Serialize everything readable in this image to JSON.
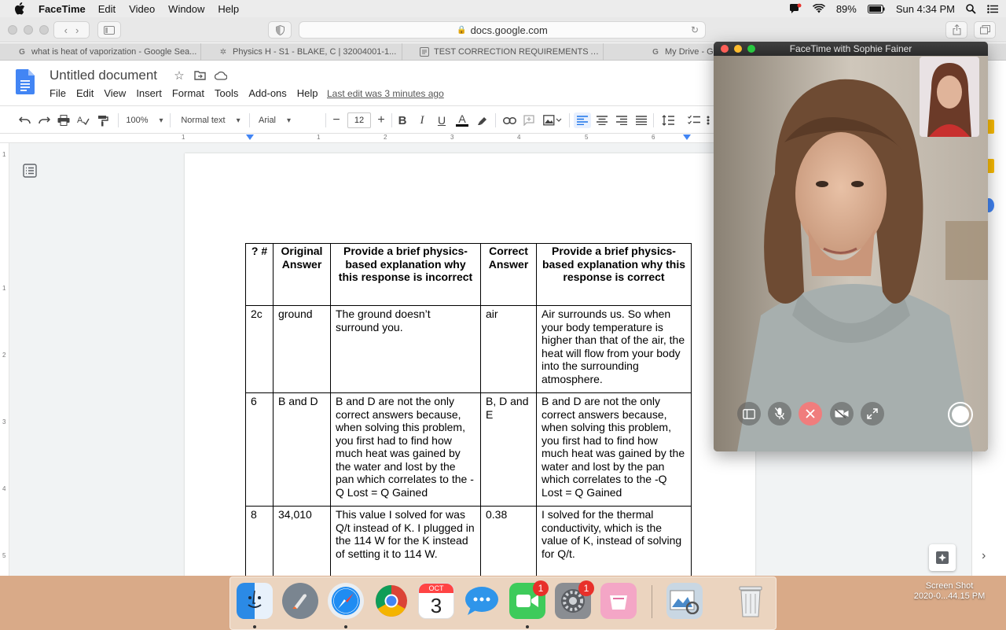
{
  "menubar": {
    "app_name": "FaceTime",
    "menus": [
      "Edit",
      "Video",
      "Window",
      "Help"
    ],
    "battery_percent": "89%",
    "clock": "Sun 4:34 PM"
  },
  "safari": {
    "address": "docs.google.com",
    "tabs": [
      {
        "label": "what is heat of vaporization - Google Sea...",
        "icon": "google-icon"
      },
      {
        "label": "Physics H - S1 - BLAKE, C | 32004001-1...",
        "icon": "schoology-icon"
      },
      {
        "label": "TEST CORRECTION REQUIREMENTS A...",
        "icon": "docs-icon"
      },
      {
        "label": "My Drive - Google Drive",
        "icon": "google-icon"
      }
    ]
  },
  "docs": {
    "title": "Untitled document",
    "menus": [
      "File",
      "Edit",
      "View",
      "Insert",
      "Format",
      "Tools",
      "Add-ons",
      "Help"
    ],
    "last_edit": "Last edit was 3 minutes ago",
    "toolbar": {
      "zoom": "100%",
      "style": "Normal text",
      "font": "Arial",
      "font_size": "12"
    },
    "ruler_numbers": [
      "1",
      "1",
      "2",
      "3",
      "4",
      "5",
      "6"
    ],
    "vruler_numbers": [
      "1",
      "1",
      "2",
      "3",
      "4",
      "5"
    ]
  },
  "table": {
    "headers": [
      "? #",
      "Original Answer",
      "Provide a brief physics-based explanation why this response is incorrect",
      "Correct Answer",
      "Provide a brief physics-based explanation why this response is correct"
    ],
    "rows": [
      [
        "2c",
        "ground",
        "The ground doesn’t surround you.",
        "air",
        "Air surrounds us. So when your body temperature is higher than that of the air, the heat will flow from your body into the surrounding atmosphere."
      ],
      [
        "6",
        "B and D",
        "B and D are not the only correct answers because, when solving this problem, you first had to find how much heat was gained by the water and lost by the pan which correlates to the -Q Lost = Q Gained",
        "B, D and E",
        "B and D are not the only correct answers because, when solving this problem, you first had to find how much heat was gained by the water and lost by the pan which correlates to the -Q Lost = Q Gained"
      ],
      [
        "8",
        "34,010",
        "This value I solved for was Q/t instead of K. I plugged in the 114 W for the K instead of setting it to 114 W.",
        "0.38",
        "I solved for the thermal conductivity, which is the value of K, instead of solving for Q/t."
      ]
    ]
  },
  "facetime": {
    "window_title": "FaceTime with Sophie Fainer"
  },
  "dock": {
    "calendar_month": "OCT",
    "calendar_day": "3",
    "facetime_badge": "1",
    "settings_badge": "1"
  },
  "desktop": {
    "screenshot_label_1": "Screen Shot",
    "screenshot_label_2": "2020-0...44.15 PM"
  }
}
